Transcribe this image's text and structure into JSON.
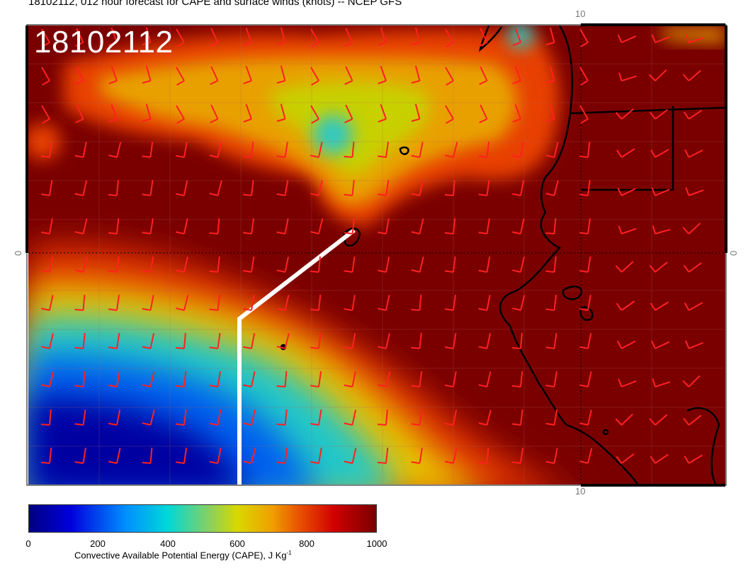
{
  "header": {
    "title": "18102112, 012 hour forecast for CAPE and surface winds (knots) -- NCEP GFS",
    "date_stamp": "18102112"
  },
  "axes": {
    "top_label": "10",
    "bottom_label": "10",
    "left_label": "0",
    "right_label": "0"
  },
  "colorbar": {
    "ticks": [
      "0",
      "200",
      "400",
      "600",
      "800",
      "1000"
    ],
    "label_main": "Convective Available Potential Energy (CAPE), J Kg",
    "label_sup": "-1",
    "colors": [
      "#000080",
      "#0000dd",
      "#0090ff",
      "#00d8d8",
      "#d8d800",
      "#f0a000",
      "#e85000",
      "#d00000",
      "#7a0000"
    ]
  },
  "map": {
    "background_color": "#7a0000",
    "wind_barb_color": "#ff2020",
    "coastline_color": "#000000",
    "route_color": "#ffffff",
    "grid_color": "#b06060"
  }
}
